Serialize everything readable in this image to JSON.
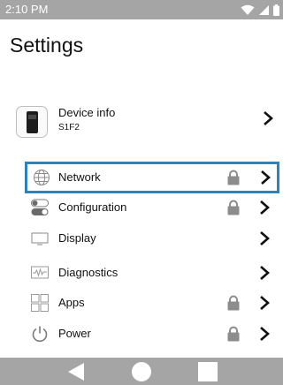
{
  "status_bar": {
    "time": "2:10 PM",
    "icons": [
      "wifi-icon",
      "signal-icon",
      "battery-icon"
    ]
  },
  "header": {
    "title": "Settings"
  },
  "device": {
    "name": "Device info",
    "model": "S1F2",
    "icon": "device-thumbnail-icon"
  },
  "menu": {
    "items": [
      {
        "label": "Network",
        "icon": "globe-icon",
        "locked": true,
        "selected": true
      },
      {
        "label": "Configuration",
        "icon": "toggle-icon",
        "locked": true
      },
      {
        "label": "Display",
        "icon": "monitor-icon",
        "locked": false
      },
      {
        "label": "Diagnostics",
        "icon": "waveform-icon",
        "locked": false
      },
      {
        "label": "Apps",
        "icon": "grid-icon",
        "locked": true
      },
      {
        "label": "Power",
        "icon": "power-icon",
        "locked": true
      }
    ]
  },
  "nav_bar": {
    "buttons": [
      "back-icon",
      "home-icon",
      "recents-icon"
    ]
  },
  "colors": {
    "status_bar": "#a5a5a5",
    "nav_bar": "#a5a5a5",
    "selection_border": "#2b83b8",
    "lock": "#8c8c8c"
  }
}
